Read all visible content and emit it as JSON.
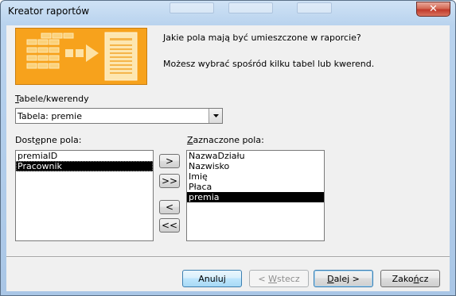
{
  "window": {
    "title": "Kreator raportów",
    "close_glyph": "✕"
  },
  "wizard": {
    "question": "Jakie pola mają być umieszczone w raporcie?",
    "hint": "Możesz wybrać spośród kilku tabel lub kwerend.",
    "illustration": "report-wizard-illustration-icon"
  },
  "tables": {
    "label_mnemonic": "T",
    "label_rest": "abele/kwerendy",
    "selected": "Tabela: premie",
    "dropdown_icon": "chevron-down-icon"
  },
  "available": {
    "label_pre": "Dost",
    "label_mnemonic": "ę",
    "label_post": "pne pola:",
    "items": [
      "premiaID",
      "Pracownik"
    ],
    "selected_index": 1
  },
  "selected_fields": {
    "label_mnemonic": "Z",
    "label_rest": "aznaczone pola:",
    "items": [
      "NazwaDziału",
      "Nazwisko",
      "Imię",
      "Płaca",
      "premia"
    ],
    "selected_index": 4
  },
  "move_buttons": {
    "add_one": ">",
    "add_all": ">>",
    "remove_one": "<",
    "remove_all": "<<"
  },
  "footer": {
    "cancel": "Anuluj",
    "back_pre": "< ",
    "back_mnemonic": "W",
    "back_post": "stecz",
    "next_pre": "",
    "next_mnemonic": "D",
    "next_post": "alej >",
    "finish_pre": "Zako",
    "finish_mnemonic": "ń",
    "finish_post": "cz"
  },
  "colors": {
    "illustration_orange": "#f7a21c",
    "selection": "#000000",
    "close_red": "#c0392b",
    "title_bar": "#b9d3ee"
  }
}
